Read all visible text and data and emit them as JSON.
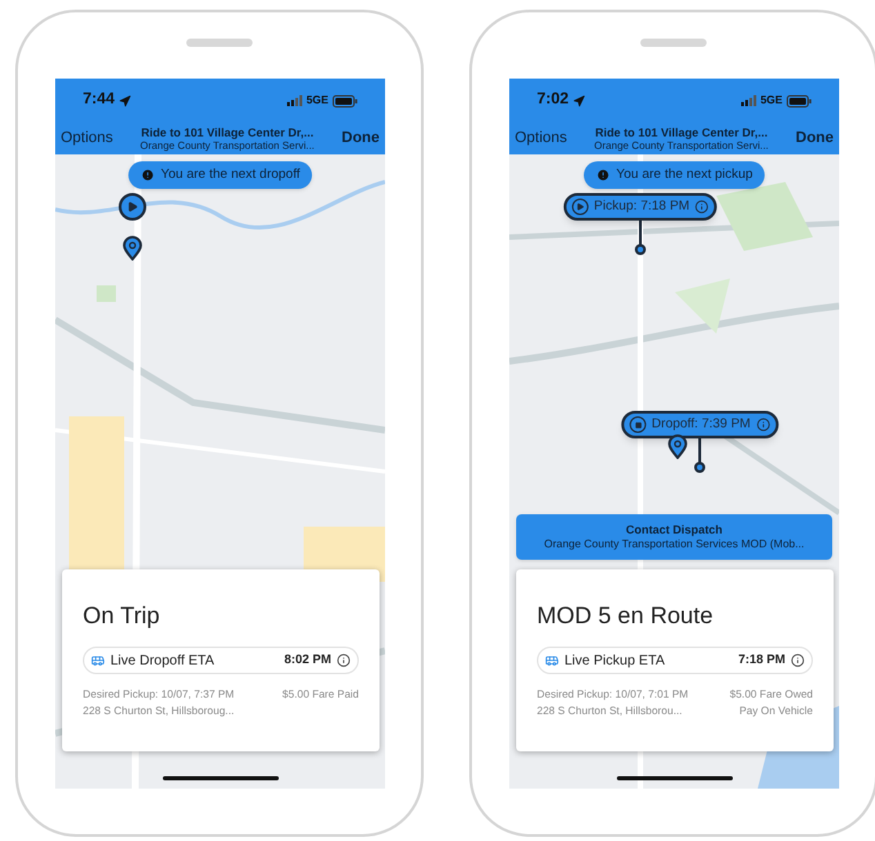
{
  "phones": [
    {
      "status_bar": {
        "time": "7:44",
        "network": "5GE"
      },
      "nav": {
        "left": "Options",
        "title": "Ride to 101 Village Center Dr,...",
        "subtitle": "Orange County Transportation Servi...",
        "right": "Done"
      },
      "notice": "You are the next dropoff",
      "pins": [
        {
          "kind": "current"
        },
        {
          "kind": "stop"
        }
      ],
      "card": {
        "title": "On Trip",
        "eta_label": "Live Dropoff ETA",
        "eta_time": "8:02 PM",
        "desired_pickup": "Desired Pickup: 10/07, 7:37 PM",
        "address": "228 S Churton St, Hillsboroug...",
        "fare": [
          "$5.00 Fare Paid"
        ]
      }
    },
    {
      "status_bar": {
        "time": "7:02",
        "network": "5GE"
      },
      "nav": {
        "left": "Options",
        "title": "Ride to 101 Village Center Dr,...",
        "subtitle": "Orange County Transportation Servi...",
        "right": "Done"
      },
      "notice": "You are the next pickup",
      "pins": [
        {
          "kind": "pickup",
          "label": "Pickup: 7:18 PM"
        },
        {
          "kind": "dropoff",
          "label": "Dropoff: 7:39 PM"
        },
        {
          "kind": "stop"
        }
      ],
      "contact_dispatch": {
        "title": "Contact Dispatch",
        "subtitle": "Orange County Transportation Services MOD (Mob..."
      },
      "card": {
        "title": "MOD 5 en Route",
        "eta_label": "Live Pickup ETA",
        "eta_time": "7:18 PM",
        "desired_pickup": "Desired Pickup: 10/07, 7:01 PM",
        "address": "228 S Churton St, Hillsborou...",
        "fare": [
          "$5.00 Fare Owed",
          "Pay On Vehicle"
        ]
      }
    }
  ]
}
